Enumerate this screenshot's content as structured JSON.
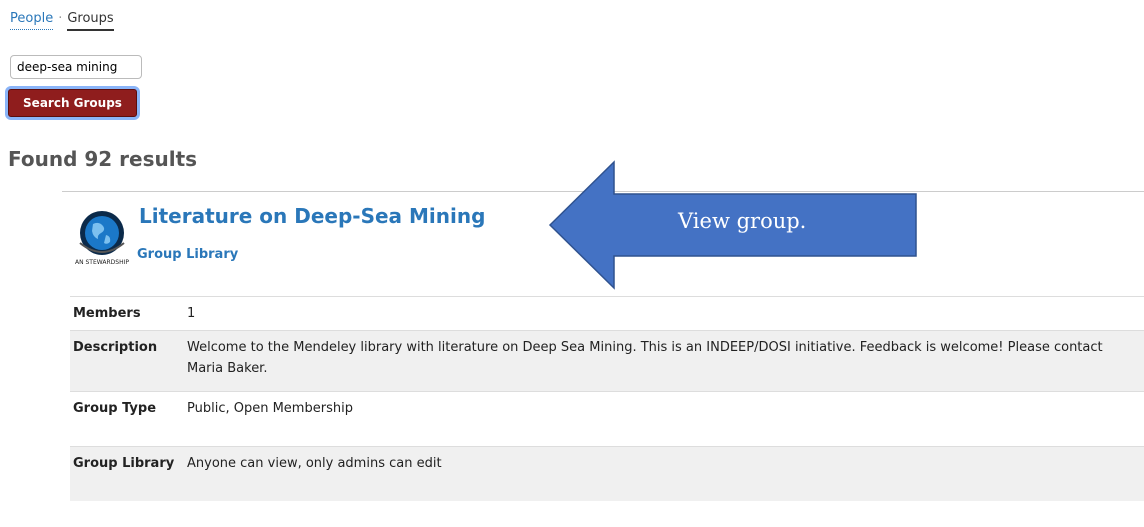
{
  "nav": {
    "people": "People",
    "separator": "·",
    "groups": "Groups"
  },
  "search": {
    "value": "deep-sea mining",
    "button": "Search Groups"
  },
  "results": {
    "heading": "Found 92 results"
  },
  "group": {
    "title": "Literature on Deep-Sea Mining",
    "library_link": "Group Library",
    "logo_text": "AN STEWARDSHIP"
  },
  "callout": {
    "text": "View group.",
    "color": "#4472c4"
  },
  "details": [
    {
      "label": "Members",
      "value": "1"
    },
    {
      "label": "Description",
      "value": "Welcome to the Mendeley library with literature on Deep Sea Mining. This is an INDEEP/DOSI initiative. Feedback is welcome! Please contact Maria Baker."
    },
    {
      "label": "Group Type",
      "value": "Public, Open Membership"
    },
    {
      "label": "Group Library",
      "value": "Anyone can view, only admins can edit"
    }
  ]
}
